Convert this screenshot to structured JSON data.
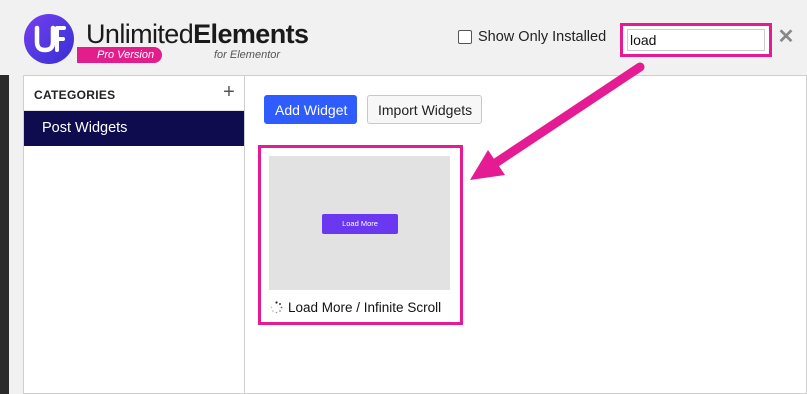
{
  "header": {
    "logo": {
      "name_part1": "Unlimited",
      "name_part2": "Elements",
      "badge": "Pro Version",
      "subtitle": "for Elementor",
      "icon": "unlimited-elements-logo-icon"
    },
    "show_only_installed": {
      "label": "Show Only Installed",
      "checked": false
    },
    "search": {
      "value": "load",
      "clear_icon": "close-icon"
    }
  },
  "sidebar": {
    "title": "CATEGORIES",
    "add_icon": "plus-icon",
    "categories": [
      {
        "label": "Post Widgets",
        "selected": true
      }
    ]
  },
  "toolbar": {
    "add_label": "Add Widget",
    "import_label": "Import Widgets"
  },
  "widgets": [
    {
      "title": "Load More / Infinite Scroll",
      "thumb_button_label": "Load More",
      "icon": "spinner-icon"
    }
  ],
  "annotations": {
    "highlight_color": "#e41b93",
    "arrow": "callout-arrow"
  },
  "colors": {
    "accent": "#2f5cff",
    "sidebar_selected": "#0e0b4e",
    "highlight": "#e41b93",
    "thumb_button": "#6a38f0"
  }
}
